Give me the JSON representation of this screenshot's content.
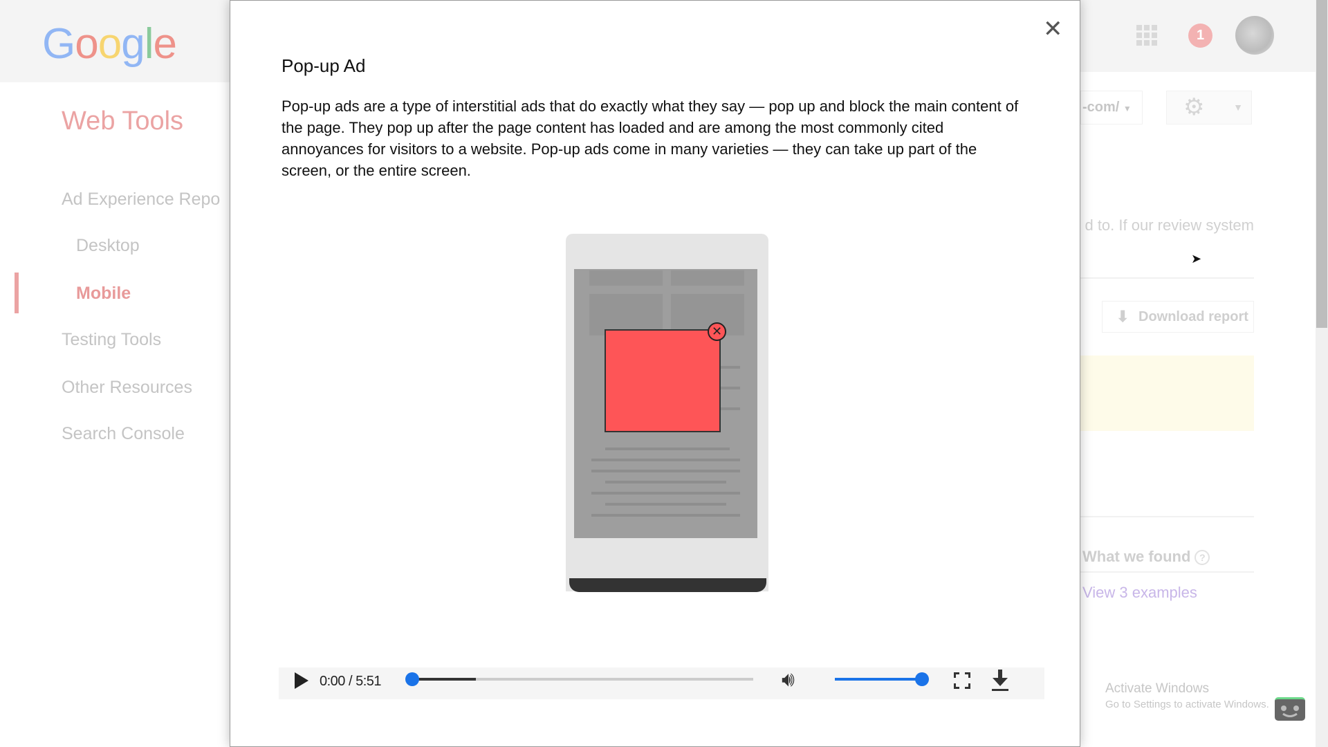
{
  "background": {
    "logo": "Google",
    "sidebar": {
      "title": "Web Tools",
      "items": [
        {
          "label": "Ad Experience Repo"
        },
        {
          "label": "Desktop"
        },
        {
          "label": "Mobile",
          "active": true
        },
        {
          "label": "Testing Tools"
        },
        {
          "label": "Other Resources"
        },
        {
          "label": "Search Console"
        }
      ]
    },
    "header": {
      "notification_count": "1",
      "apps_icon": "grid-icon",
      "gear_icon": "⚙"
    },
    "site_selector": "-com/",
    "review_text": "d to. If our review system",
    "download_report": "Download report",
    "what_we_found": "What we found",
    "help_icon": "?",
    "view_examples": "View 3 examples",
    "watermark": {
      "line1": "Activate Windows",
      "line2": "Go to Settings to activate Windows."
    }
  },
  "modal": {
    "close": "✕",
    "title": "Pop-up Ad",
    "description": "Pop-up ads are a type of interstitial ads that do exactly what they say — pop up and block the main content of the page. They pop up after the page content has loaded and are among the most commonly cited annoyances for visitors to a website. Pop-up ads come in many varieties — they can take up part of the screen, or the entire screen.",
    "ad_close_glyph": "✕",
    "video": {
      "time": "0:00 / 5:51",
      "progress_percent": 0,
      "buffered_percent": 19,
      "volume_percent": 100,
      "accent": "#1a73e8"
    }
  },
  "colors": {
    "ad_red": "#fe5557",
    "brand_red": "#eba3a3"
  }
}
